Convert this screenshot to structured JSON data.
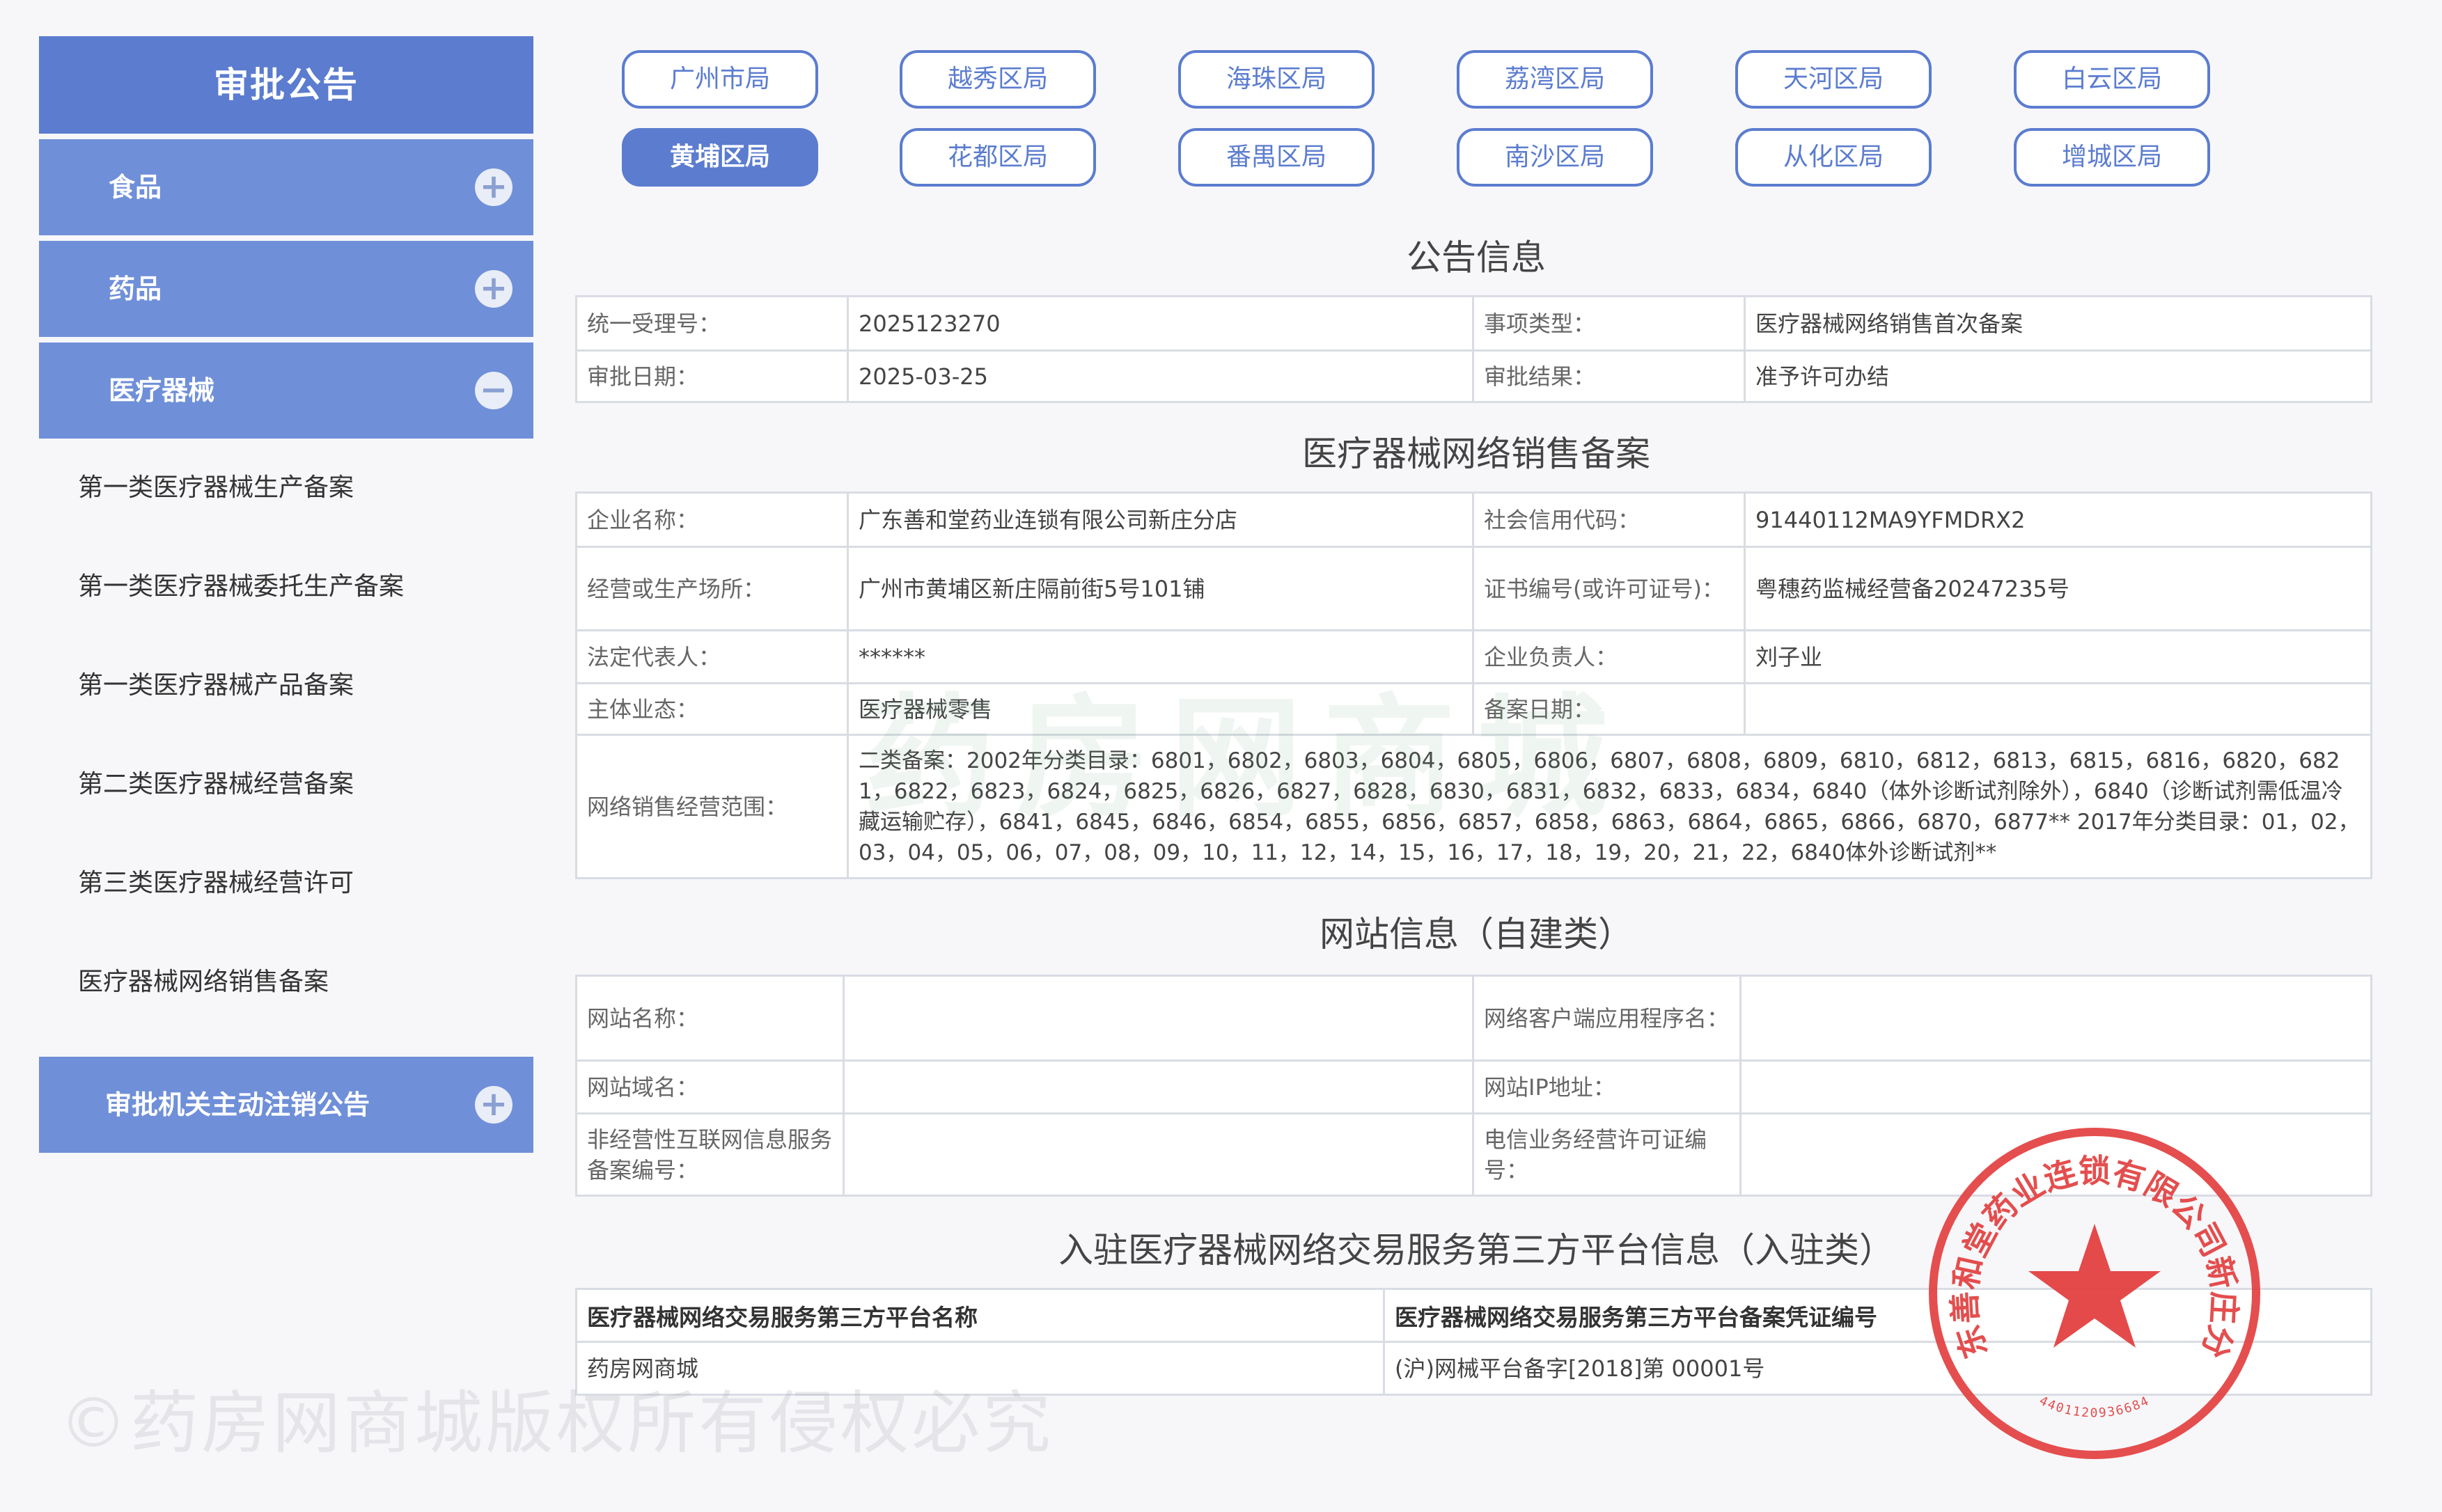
{
  "sidebar": {
    "title": "审批公告",
    "categories": [
      {
        "label": "食品",
        "icon": "+"
      },
      {
        "label": "药品",
        "icon": "+"
      },
      {
        "label": "医疗器械",
        "icon": "−"
      }
    ],
    "subitems": [
      "第一类医疗器械生产备案",
      "第一类医疗器械委托生产备案",
      "第一类医疗器械产品备案",
      "第二类医疗器械经营备案",
      "第三类医疗器械经营许可",
      "医疗器械网络销售备案"
    ],
    "cancel": {
      "label": "审批机关主动注销公告",
      "icon": "+"
    }
  },
  "regions": [
    {
      "label": "广州市局",
      "active": false
    },
    {
      "label": "越秀区局",
      "active": false
    },
    {
      "label": "海珠区局",
      "active": false
    },
    {
      "label": "荔湾区局",
      "active": false
    },
    {
      "label": "天河区局",
      "active": false
    },
    {
      "label": "白云区局",
      "active": false
    },
    {
      "label": "黄埔区局",
      "active": true
    },
    {
      "label": "花都区局",
      "active": false
    },
    {
      "label": "番禺区局",
      "active": false
    },
    {
      "label": "南沙区局",
      "active": false
    },
    {
      "label": "从化区局",
      "active": false
    },
    {
      "label": "增城区局",
      "active": false
    }
  ],
  "announcement": {
    "title": "公告信息",
    "accept_no_label": "统一受理号：",
    "accept_no": "2025123270",
    "type_label": "事项类型：",
    "type": "医疗器械网络销售首次备案",
    "date_label": "审批日期：",
    "date": "2025-03-25",
    "result_label": "审批结果：",
    "result": "准予许可办结"
  },
  "filing": {
    "title": "医疗器械网络销售备案",
    "company_label": "企业名称：",
    "company": "广东善和堂药业连锁有限公司新庄分店",
    "credit_label": "社会信用代码：",
    "credit": "91440112MA9YFMDRX2",
    "address_label": "经营或生产场所：",
    "address": "广州市黄埔区新庄隔前街5号101铺",
    "cert_label": "证书编号(或许可证号)：",
    "cert": "粤穗药监械经营备20247235号",
    "legal_label": "法定代表人：",
    "legal": "******",
    "manager_label": "企业负责人：",
    "manager": "刘子业",
    "form_label": "主体业态：",
    "form": "医疗器械零售",
    "filing_date_label": "备案日期：",
    "filing_date": "",
    "scope_label": "网络销售经营范围：",
    "scope": "二类备案：2002年分类目录：6801，6802，6803，6804，6805，6806，6807，6808，6809，6810，6812，6813，6815，6816，6820，6821，6822，6823，6824，6825，6826，6827，6828，6830，6831，6832，6833，6834，6840（体外诊断试剂除外），6840（诊断试剂需低温冷藏运输贮存），6841，6845，6846，6854，6855，6856，6857，6858，6863，6864，6865，6866，6870，6877** 2017年分类目录：01，02，03，04，05，06，07，08，09，10，11，12，14，15，16，17，18，19，20，21，22，6840体外诊断试剂**"
  },
  "website": {
    "title": "网站信息（自建类）",
    "name_label": "网站名称：",
    "name": "",
    "app_label": "网络客户端应用程序名：",
    "app": "",
    "domain_label": "网站域名：",
    "domain": "",
    "ip_label": "网站IP地址：",
    "ip": "",
    "icp_label": "非经营性互联网信息服务备案编号：",
    "icp": "",
    "telecom_label": "电信业务经营许可证编号：",
    "telecom": ""
  },
  "platform": {
    "title": "入驻医疗器械网络交易服务第三方平台信息（入驻类）",
    "col_name": "医疗器械网络交易服务第三方平台名称",
    "col_cert": "医疗器械网络交易服务第三方平台备案凭证编号",
    "rows": [
      {
        "name": "药房网商城",
        "cert": "(沪)网械平台备字[2018]第 00001号"
      }
    ]
  },
  "watermarks": {
    "center": "药房网商城",
    "bottom": "©药房网商城版权所有侵权必究"
  },
  "seal": {
    "text": "广东善和堂药业连锁有限公司新庄分店",
    "code": "4401120936684",
    "color": "#e23b3b"
  },
  "colors": {
    "accent": "#5b7ccf",
    "accent_light": "#6f8fd8"
  }
}
